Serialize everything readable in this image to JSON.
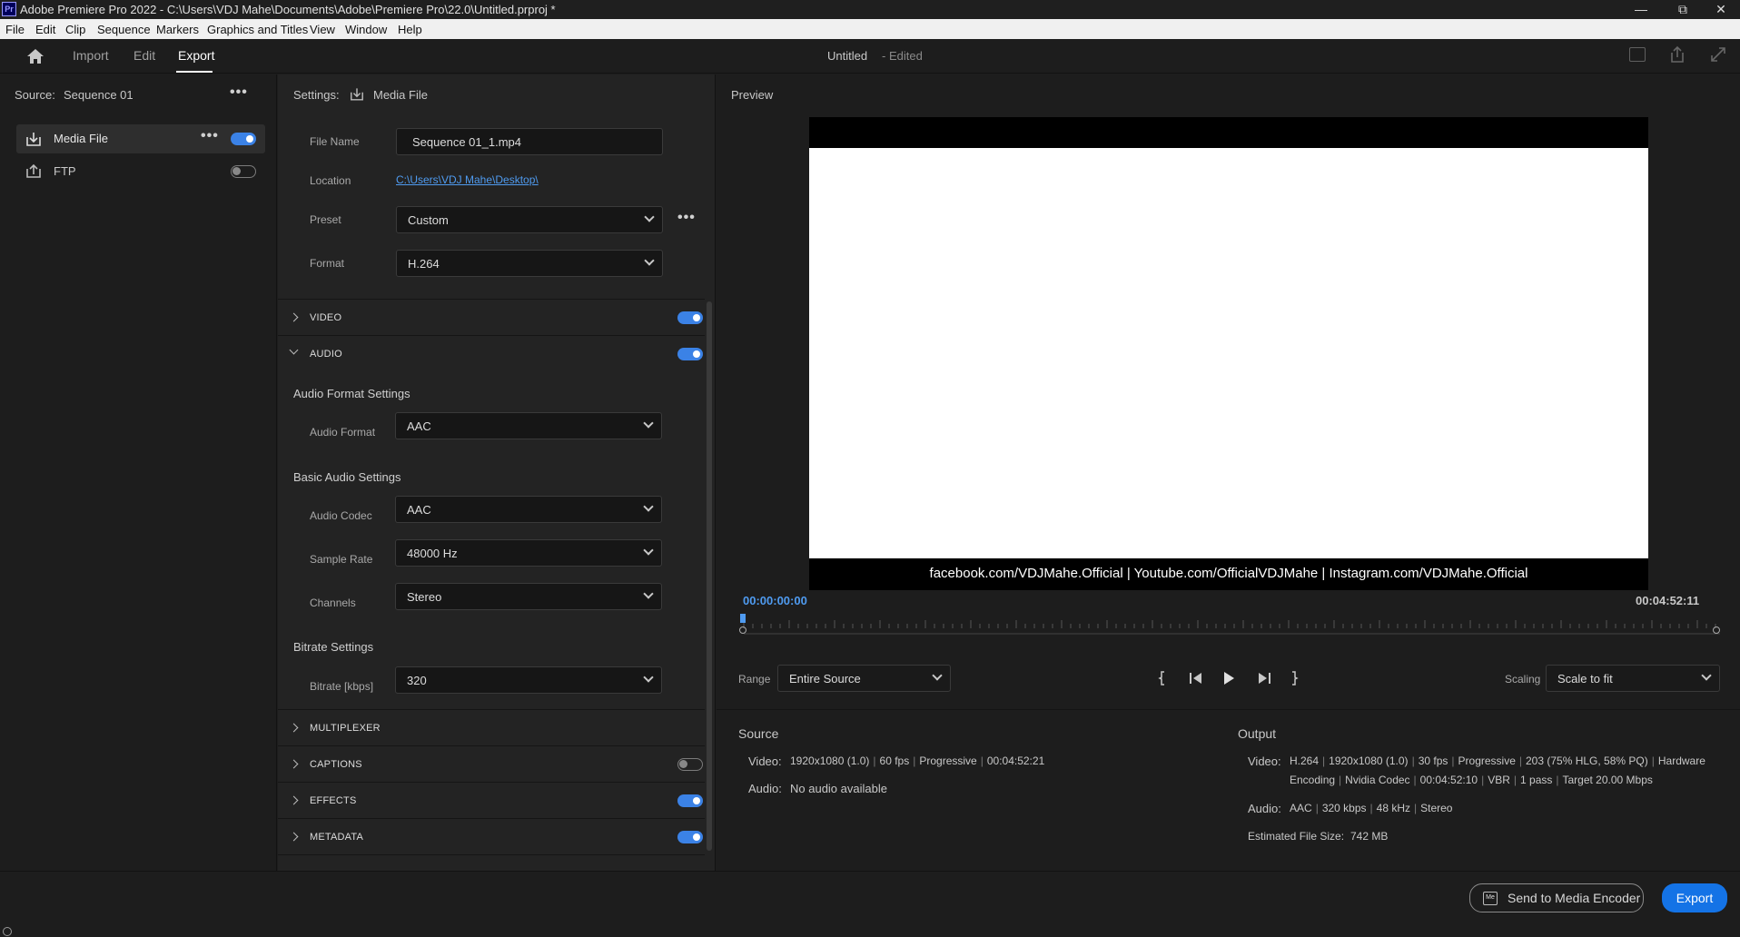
{
  "window": {
    "app_icon": "Pr",
    "title": "Adobe Premiere Pro 2022 - C:\\Users\\VDJ Mahe\\Documents\\Adobe\\Premiere Pro\\22.0\\Untitled.prproj *",
    "controls": [
      "minimize-icon",
      "restore-icon",
      "close-icon"
    ]
  },
  "menubar": [
    "File",
    "Edit",
    "Clip",
    "Sequence",
    "Markers",
    "Graphics and Titles",
    "View",
    "Window",
    "Help"
  ],
  "header": {
    "tabs": [
      {
        "label": "Import",
        "active": false
      },
      {
        "label": "Edit",
        "active": false
      },
      {
        "label": "Export",
        "active": true
      }
    ],
    "project_title": "Untitled",
    "project_status": "- Edited",
    "icons": [
      "home-icon",
      "quick-export-icon",
      "share-icon",
      "fullscreen-icon"
    ]
  },
  "left": {
    "source_label": "Source:",
    "source_value": "Sequence 01",
    "destinations": [
      {
        "label": "Media File",
        "enabled": true,
        "icon": "media-file-icon"
      },
      {
        "label": "FTP",
        "enabled": false,
        "icon": "ftp-upload-icon"
      }
    ]
  },
  "settings": {
    "label": "Settings:",
    "target": "Media File",
    "file_name_label": "File Name",
    "file_name": "Sequence 01_1.mp4",
    "location_label": "Location",
    "location": "C:\\Users\\VDJ Mahe\\Desktop\\",
    "preset_label": "Preset",
    "preset": "Custom",
    "format_label": "Format",
    "format": "H.264",
    "sections": {
      "video": {
        "label": "VIDEO",
        "enabled": true
      },
      "audio": {
        "label": "AUDIO",
        "enabled": true
      },
      "multiplexer": {
        "label": "MULTIPLEXER"
      },
      "captions": {
        "label": "CAPTIONS",
        "enabled": false
      },
      "effects": {
        "label": "EFFECTS",
        "enabled": true
      },
      "metadata": {
        "label": "METADATA",
        "enabled": true
      }
    },
    "audio": {
      "format_heading": "Audio Format Settings",
      "audio_format_label": "Audio Format",
      "audio_format": "AAC",
      "basic_heading": "Basic Audio Settings",
      "codec_label": "Audio Codec",
      "codec": "AAC",
      "sample_rate_label": "Sample Rate",
      "sample_rate": "48000 Hz",
      "channels_label": "Channels",
      "channels": "Stereo",
      "bitrate_heading": "Bitrate Settings",
      "bitrate_label": "Bitrate [kbps]",
      "bitrate": "320"
    }
  },
  "preview": {
    "label": "Preview",
    "overlay_text": "facebook.com/VDJMahe.Official | Youtube.com/OfficialVDJMahe | Instagram.com/VDJMahe.Official",
    "timecode_current": "00:00:00:00",
    "timecode_end": "00:04:52:11",
    "range_label": "Range",
    "range_value": "Entire Source",
    "scaling_label": "Scaling",
    "scaling_value": "Scale to fit",
    "transport": [
      "mark-in-icon",
      "step-back-icon",
      "play-icon",
      "step-forward-icon",
      "mark-out-icon"
    ]
  },
  "source_info": {
    "heading": "Source",
    "video_label": "Video:",
    "video_parts": [
      "1920x1080 (1.0)",
      "60 fps",
      "Progressive",
      "00:04:52:21"
    ],
    "audio_label": "Audio:",
    "audio_value": "No audio available"
  },
  "output_info": {
    "heading": "Output",
    "video_label": "Video:",
    "video_line1": [
      "H.264",
      "1920x1080 (1.0)",
      "30 fps",
      "Progressive",
      "203 (75% HLG, 58% PQ)",
      "Hardware"
    ],
    "video_line2": [
      "Encoding",
      "Nvidia Codec",
      "00:04:52:10",
      "VBR",
      "1 pass",
      "Target 20.00 Mbps"
    ],
    "audio_label": "Audio:",
    "audio_parts": [
      "AAC",
      "320 kbps",
      "48 kHz",
      "Stereo"
    ],
    "size_label": "Estimated File Size:",
    "size_value": "742 MB"
  },
  "footer": {
    "send_label": "Send to Media Encoder",
    "me_icon_text": "Me",
    "export_label": "Export"
  },
  "colors": {
    "accent": "#3b82e6",
    "link": "#4f9bf0",
    "timecode": "#4f9bf0"
  }
}
